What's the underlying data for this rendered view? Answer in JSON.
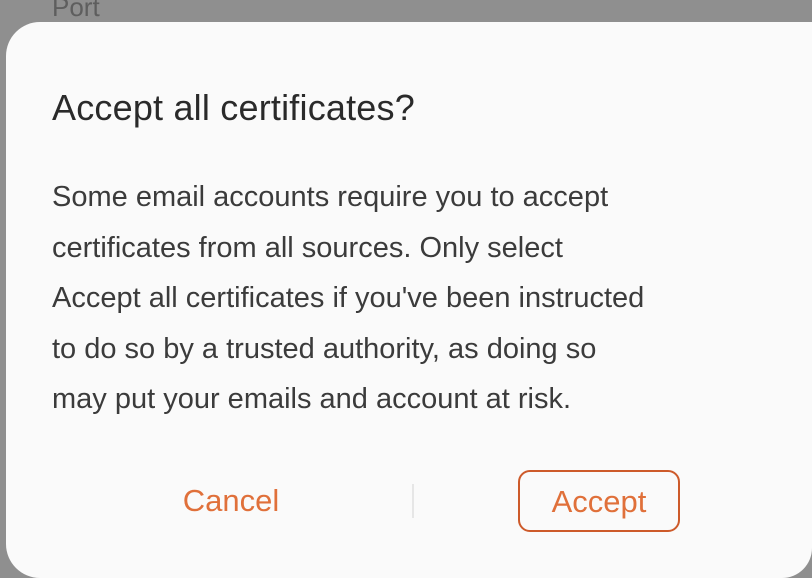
{
  "background": {
    "partial_label": "Port"
  },
  "dialog": {
    "title": "Accept all certificates?",
    "message_lines": [
      "Some email accounts require you to accept",
      "certificates from all sources. Only select",
      "Accept all certificates if you've been instructed",
      "to do so by a trusted authority, as doing so",
      "may put your emails and account at risk."
    ],
    "buttons": {
      "cancel": "Cancel",
      "accept": "Accept"
    }
  },
  "colors": {
    "accent": "#e0703a",
    "accept_border": "#cd5a2a",
    "dialog_background": "#fafafa",
    "scrim": "#8f8f8f"
  }
}
